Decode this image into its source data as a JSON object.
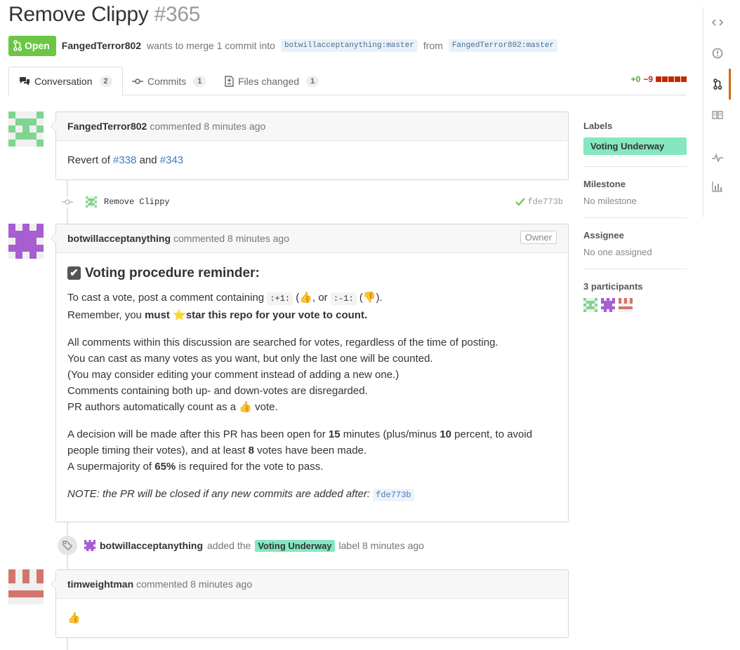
{
  "pr": {
    "title": "Remove Clippy",
    "number": "#365",
    "state": "Open",
    "author": "FangedTerror802",
    "merge_text": "wants to merge 1 commit into",
    "base_branch": "botwillacceptanything:master",
    "from_text": "from",
    "head_branch": "FangedTerror802:master"
  },
  "tabs": [
    {
      "label": "Conversation",
      "count": "2"
    },
    {
      "label": "Commits",
      "count": "1"
    },
    {
      "label": "Files changed",
      "count": "1"
    }
  ],
  "diffstat": {
    "additions": "+0",
    "deletions": "−9"
  },
  "comments": [
    {
      "author": "FangedTerror802",
      "meta": "commented 8 minutes ago",
      "body_prefix": "Revert of",
      "link1": "#338",
      "and": "and",
      "link2": "#343"
    },
    {
      "author": "botwillacceptanything",
      "meta": "commented 8 minutes ago",
      "badge": "Owner",
      "heading": "Voting procedure reminder:",
      "p1_a": "To cast a vote, post a comment containing",
      "code_up": ":+1:",
      "p1_b": ", or",
      "code_down": ":-1:",
      "p1_c": ").",
      "p1_line2_a": "Remember, you",
      "p1_must": "must",
      "p1_star": "star this repo for your vote to count.",
      "p2": [
        "All comments within this discussion are searched for votes, regardless of the time of posting.",
        "You can cast as many votes as you want, but only the last one will be counted.",
        "(You may consider editing your comment instead of adding a new one.)",
        "Comments containing both up- and down-votes are disregarded."
      ],
      "p2_last_a": "PR authors automatically count as a",
      "p2_last_b": "vote.",
      "p3_a": "A decision will be made after this PR has been open for",
      "p3_minutes": "15",
      "p3_b": "minutes (plus/minus",
      "p3_pct": "10",
      "p3_c": "percent, to avoid",
      "p3_d": "people timing their votes), and at least",
      "p3_votes": "8",
      "p3_e": "votes have been made.",
      "p3_f": "A supermajority of",
      "p3_super": "65%",
      "p3_g": "is required for the vote to pass.",
      "note": "NOTE: the PR will be closed if any new commits are added after:",
      "note_sha": "fde773b"
    },
    {
      "author": "timweightman",
      "meta": "commented 8 minutes ago"
    }
  ],
  "commit": {
    "message": "Remove Clippy",
    "sha": "fde773b"
  },
  "label_event": {
    "actor": "botwillacceptanything",
    "added_the": "added the",
    "label": "Voting Underway",
    "suffix": "label 8 minutes ago"
  },
  "sidebar": {
    "labels_heading": "Labels",
    "label": "Voting Underway",
    "milestone_heading": "Milestone",
    "milestone_value": "No milestone",
    "assignee_heading": "Assignee",
    "assignee_value": "No one assigned",
    "participants_heading": "3 participants"
  },
  "colors": {
    "open_green": "#6cc644",
    "label_green": "#85e7c0",
    "deletion_red": "#bd2c00",
    "nav_active": "#d26911"
  }
}
